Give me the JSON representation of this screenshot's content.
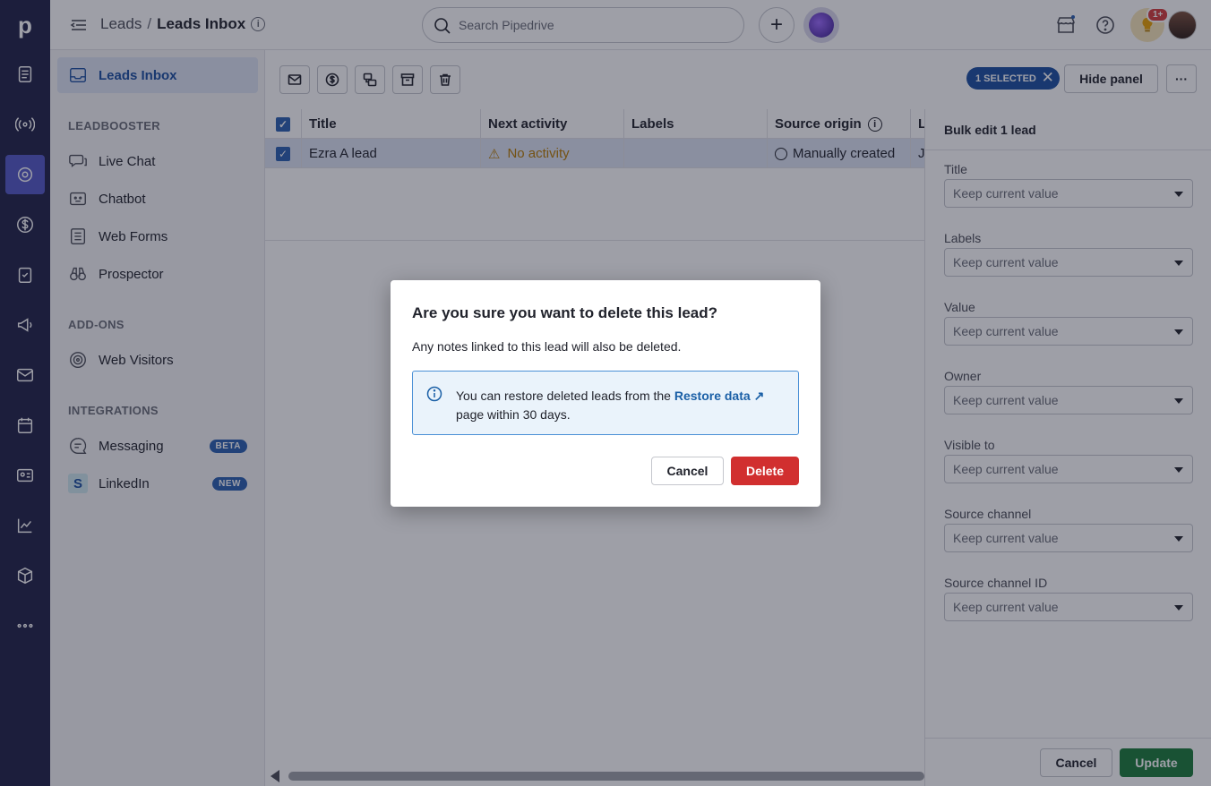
{
  "header": {
    "breadcrumb_parent": "Leads",
    "breadcrumb_sep": "/",
    "breadcrumb_current": "Leads Inbox",
    "search_placeholder": "Search Pipedrive",
    "notification_badge": "1+"
  },
  "sidebar": {
    "active_item": "Leads Inbox",
    "sections": [
      {
        "title": "LEADBOOSTER",
        "items": [
          "Live Chat",
          "Chatbot",
          "Web Forms",
          "Prospector"
        ]
      },
      {
        "title": "ADD-ONS",
        "items": [
          "Web Visitors"
        ]
      },
      {
        "title": "INTEGRATIONS",
        "items": [
          "Messaging",
          "LinkedIn"
        ]
      }
    ],
    "badges": {
      "messaging": "BETA",
      "linkedin": "NEW"
    }
  },
  "toolbar": {
    "selected_label": "1 SELECTED",
    "hide_panel": "Hide panel",
    "more": "···"
  },
  "table": {
    "columns": [
      "Title",
      "Next activity",
      "Labels",
      "Source origin",
      "L"
    ],
    "rows": [
      {
        "title": "Ezra A lead",
        "next_activity": "No activity",
        "labels": "",
        "source_origin": "Manually created",
        "l": "J"
      }
    ]
  },
  "panel": {
    "title": "Bulk edit 1 lead",
    "fields": [
      {
        "label": "Title",
        "value": "Keep current value"
      },
      {
        "label": "Labels",
        "value": "Keep current value"
      },
      {
        "label": "Value",
        "value": "Keep current value"
      },
      {
        "label": "Owner",
        "value": "Keep current value"
      },
      {
        "label": "Visible to",
        "value": "Keep current value"
      },
      {
        "label": "Source channel",
        "value": "Keep current value"
      },
      {
        "label": "Source channel ID",
        "value": "Keep current value"
      }
    ],
    "cancel": "Cancel",
    "update": "Update"
  },
  "modal": {
    "title": "Are you sure you want to delete this lead?",
    "message": "Any notes linked to this lead will also be deleted.",
    "info_prefix": "You can restore deleted leads from the ",
    "info_link": "Restore data",
    "info_suffix": "page within 30 days.",
    "cancel": "Cancel",
    "delete": "Delete"
  },
  "colors": {
    "rail_bg": "#1f2148",
    "accent_blue": "#1a4fa0",
    "delete_red": "#d12f2f",
    "update_green": "#1a7a3a"
  }
}
